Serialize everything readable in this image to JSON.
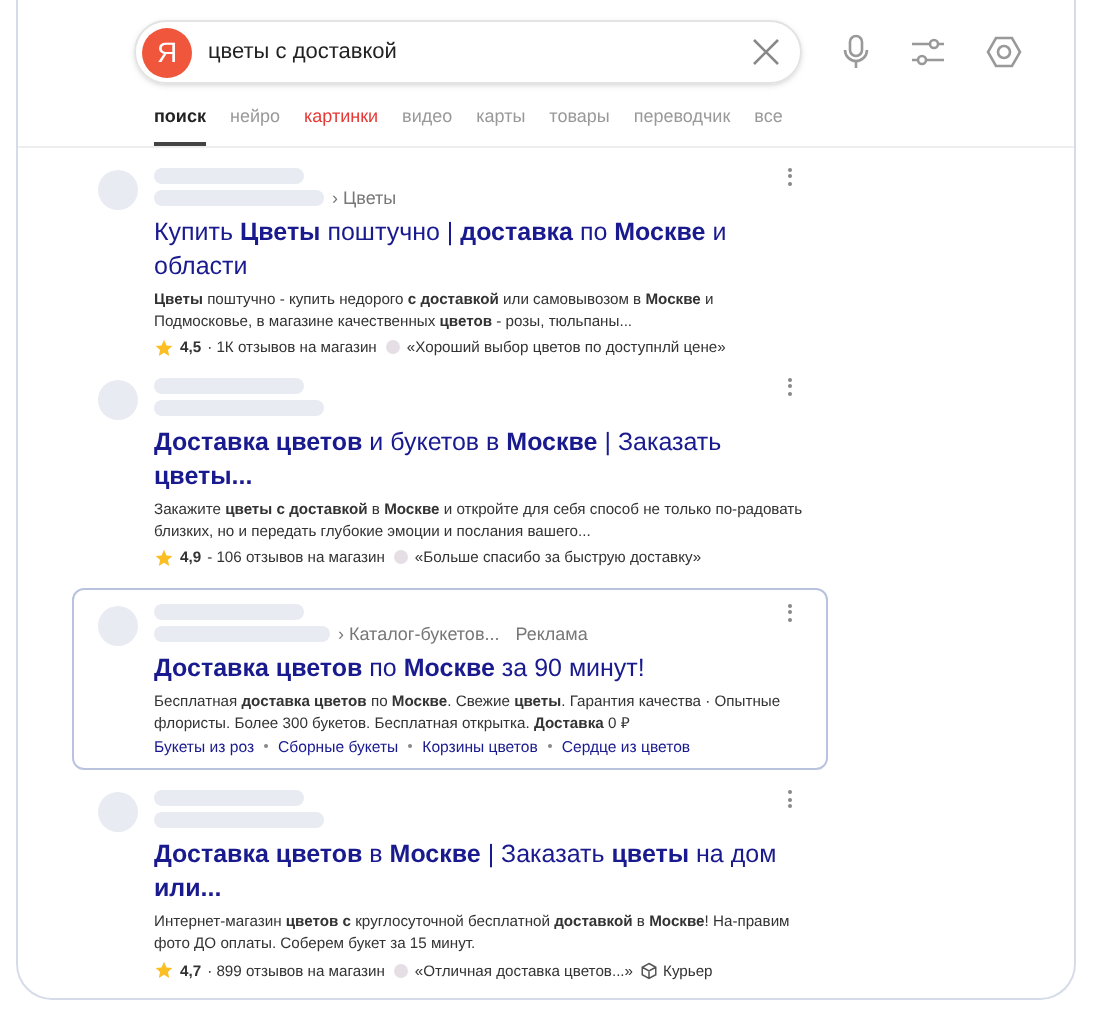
{
  "search": {
    "logo": "Я",
    "query": "цветы с доставкой"
  },
  "tabs": [
    {
      "label": "поиск",
      "selected": true,
      "accent": false
    },
    {
      "label": "нейро",
      "selected": false,
      "accent": false
    },
    {
      "label": "картинки",
      "selected": false,
      "accent": true
    },
    {
      "label": "видео",
      "selected": false,
      "accent": false
    },
    {
      "label": "карты",
      "selected": false,
      "accent": false
    },
    {
      "label": "товары",
      "selected": false,
      "accent": false
    },
    {
      "label": "переводчик",
      "selected": false,
      "accent": false
    },
    {
      "label": "все",
      "selected": false,
      "accent": false
    }
  ],
  "results": [
    {
      "ad": false,
      "breadcrumb": "› Цветы",
      "title": "Купить **Цветы** поштучно | **доставка** по **Москве** и области",
      "snippet": "**Цветы** поштучно - купить недорого **с доставкой** или самовывозом в **Москве** и Подмосковье, в магазине качественных **цветов** - розы, тюльпаны...",
      "rating": {
        "value": "4,5",
        "reviews": "· 1К отзывов на магазин",
        "quote": "«Хороший выбор цветов по доступнлй цене»"
      }
    },
    {
      "ad": false,
      "title": "**Доставка цветов** и букетов в **Москве** | Заказать **цветы...**",
      "snippet": "Закажите **цветы с доставкой** в **Москве** и откройте для себя способ не только по-радовать близких, но и передать глубокие эмоции и послания вашего...",
      "rating": {
        "value": "4,9",
        "reviews": "- 106 отзывов на магазин",
        "quote": "«Больше спасибо за быструю доставку»"
      }
    },
    {
      "ad": true,
      "breadcrumb": "› Каталог-букетов...",
      "ad_label": "Реклама",
      "title": "**Доставка цветов** по **Москве** за 90 минут!",
      "snippet": "Бесплатная **доставка цветов** по **Москве**. Свежие **цветы**. Гарантия качества · Опытные флористы. Более 300 букетов. Бесплатная открытка. **Доставка** 0 ₽",
      "sitelinks": [
        "Букеты из роз",
        "Сборные букеты",
        "Корзины цветов",
        "Сердце из цветов"
      ]
    },
    {
      "ad": false,
      "title": "**Доставка цветов** в **Москве** | Заказать **цветы** на дом **или...**",
      "snippet": "Интернет-магазин **цветов с** круглосуточной бесплатной **доставкой** в **Москве**! На-правим фото ДО оплаты. Соберем букет за 15 минут.",
      "rating": {
        "value": "4,7",
        "reviews": "· 899 отзывов на магазин",
        "quote": "«Отличная доставка цветов...»"
      },
      "delivery": "Курьер"
    }
  ]
}
